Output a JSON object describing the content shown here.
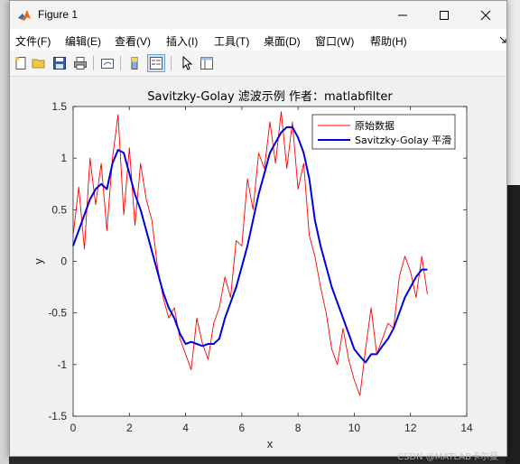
{
  "window": {
    "title": "Figure 1"
  },
  "menu": [
    {
      "label": "文件(F)"
    },
    {
      "label": "编辑(E)"
    },
    {
      "label": "查看(V)"
    },
    {
      "label": "插入(I)"
    },
    {
      "label": "工具(T)"
    },
    {
      "label": "桌面(D)"
    },
    {
      "label": "窗口(W)"
    },
    {
      "label": "帮助(H)"
    }
  ],
  "chart_data": {
    "type": "line",
    "title": "Savitzky-Golay 滤波示例 作者：matlabfilter",
    "xlabel": "x",
    "ylabel": "y",
    "xlim": [
      0,
      14
    ],
    "ylim": [
      -1.5,
      1.5
    ],
    "xticks": [
      "0",
      "2",
      "4",
      "6",
      "8",
      "10",
      "12",
      "14"
    ],
    "yticks": [
      "1.5",
      "1",
      "0.5",
      "0",
      "-0.5",
      "-1",
      "-1.5"
    ],
    "legend_position": "top-right",
    "series": [
      {
        "name": "原始数据",
        "color": "#ff0000",
        "x": [
          0,
          0.2,
          0.4,
          0.6,
          0.8,
          1.0,
          1.2,
          1.4,
          1.6,
          1.8,
          2.0,
          2.2,
          2.4,
          2.6,
          2.8,
          3.0,
          3.2,
          3.4,
          3.6,
          3.8,
          4.0,
          4.2,
          4.4,
          4.6,
          4.8,
          5.0,
          5.2,
          5.4,
          5.6,
          5.8,
          6.0,
          6.2,
          6.4,
          6.6,
          6.8,
          7.0,
          7.2,
          7.4,
          7.6,
          7.8,
          8.0,
          8.2,
          8.4,
          8.6,
          8.8,
          9.0,
          9.2,
          9.4,
          9.6,
          9.8,
          10.0,
          10.2,
          10.4,
          10.6,
          10.8,
          11.0,
          11.2,
          11.4,
          11.6,
          11.8,
          12.0,
          12.2,
          12.4,
          12.6
        ],
        "y": [
          0.25,
          0.72,
          0.12,
          1.0,
          0.55,
          0.95,
          0.3,
          1.0,
          1.42,
          0.45,
          1.1,
          0.35,
          0.95,
          0.6,
          0.4,
          -0.05,
          -0.35,
          -0.55,
          -0.45,
          -0.75,
          -0.9,
          -1.05,
          -0.55,
          -0.8,
          -0.95,
          -0.6,
          -0.45,
          -0.15,
          -0.35,
          0.2,
          0.15,
          0.8,
          0.5,
          1.05,
          0.9,
          1.35,
          0.95,
          1.45,
          0.9,
          1.35,
          0.7,
          0.95,
          0.25,
          0.05,
          -0.25,
          -0.5,
          -0.85,
          -1.0,
          -0.65,
          -0.95,
          -1.15,
          -1.3,
          -0.85,
          -0.45,
          -0.9,
          -0.75,
          -0.6,
          -0.65,
          -0.15,
          0.05,
          -0.1,
          -0.35,
          0.05,
          -0.32
        ]
      },
      {
        "name": "Savitzky-Golay 平滑",
        "color": "#0000dd",
        "x": [
          0,
          0.2,
          0.4,
          0.6,
          0.8,
          1.0,
          1.2,
          1.4,
          1.6,
          1.8,
          2.0,
          2.2,
          2.4,
          2.6,
          2.8,
          3.0,
          3.2,
          3.4,
          3.6,
          3.8,
          4.0,
          4.2,
          4.4,
          4.6,
          4.8,
          5.0,
          5.2,
          5.4,
          5.6,
          5.8,
          6.0,
          6.2,
          6.4,
          6.6,
          6.8,
          7.0,
          7.2,
          7.4,
          7.6,
          7.8,
          8.0,
          8.2,
          8.4,
          8.6,
          8.8,
          9.0,
          9.2,
          9.4,
          9.6,
          9.8,
          10.0,
          10.2,
          10.4,
          10.6,
          10.8,
          11.0,
          11.2,
          11.4,
          11.6,
          11.8,
          12.0,
          12.2,
          12.4,
          12.6
        ],
        "y": [
          0.15,
          0.3,
          0.45,
          0.6,
          0.7,
          0.75,
          0.7,
          0.95,
          1.08,
          1.05,
          0.85,
          0.65,
          0.5,
          0.3,
          0.1,
          -0.1,
          -0.3,
          -0.45,
          -0.55,
          -0.7,
          -0.8,
          -0.78,
          -0.8,
          -0.82,
          -0.8,
          -0.8,
          -0.75,
          -0.55,
          -0.4,
          -0.25,
          -0.05,
          0.15,
          0.4,
          0.65,
          0.85,
          1.05,
          1.15,
          1.25,
          1.3,
          1.3,
          1.2,
          1.05,
          0.8,
          0.4,
          0.15,
          -0.05,
          -0.25,
          -0.4,
          -0.55,
          -0.7,
          -0.85,
          -0.92,
          -0.98,
          -0.9,
          -0.9,
          -0.82,
          -0.75,
          -0.65,
          -0.5,
          -0.35,
          -0.25,
          -0.15,
          -0.08,
          -0.08
        ]
      }
    ]
  }
}
